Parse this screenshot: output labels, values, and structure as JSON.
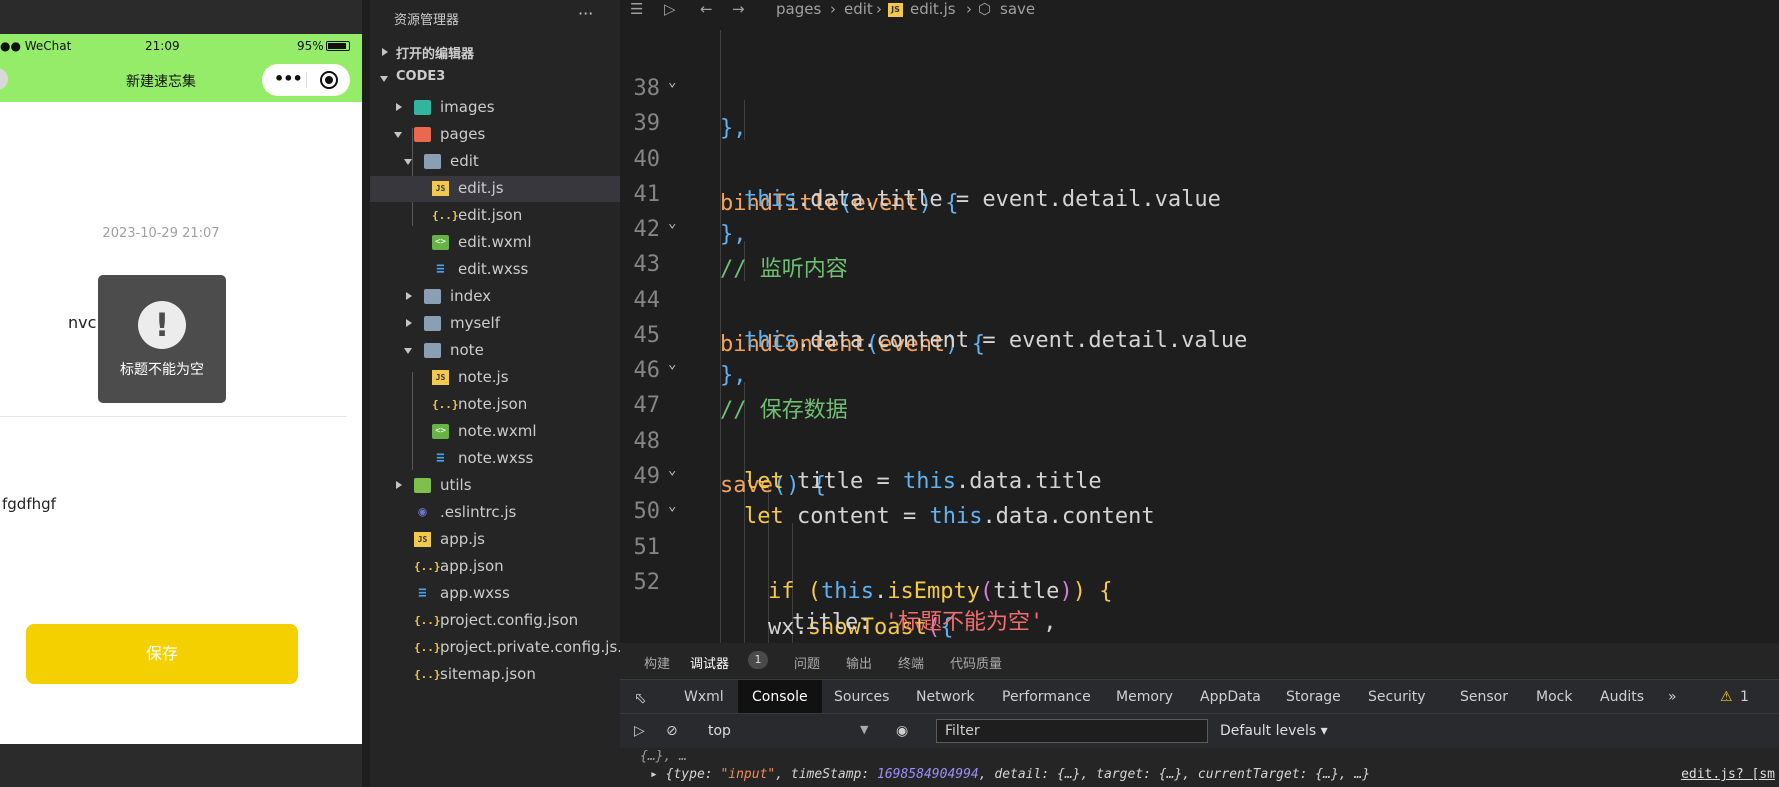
{
  "simulator": {
    "carrier": "●● WeChat",
    "time": "21:09",
    "battery": "95%",
    "nav_title": "新建速忘集",
    "capsule_more": "•••",
    "timestamp": "2023-10-29 21:07",
    "title_value": "nvc",
    "content_value": "fgdfhgf",
    "toast_icon": "!",
    "toast_message": "标题不能为空",
    "save_label": "保存",
    "colors": {
      "navbar": "#95ec69",
      "save_button": "#f5d000",
      "toast": "#4c4c4c"
    }
  },
  "explorer": {
    "header": "资源管理器",
    "more": "···",
    "open_editors": "打开的编辑器",
    "project": "CODE3",
    "tree": [
      {
        "label": "images",
        "icon": "folder-images-icon",
        "type": "folder"
      },
      {
        "label": "pages",
        "icon": "folder-pages-icon",
        "type": "folder"
      },
      {
        "label": "edit",
        "icon": "folder-icon",
        "type": "folder"
      },
      {
        "label": "edit.js",
        "icon": "js-file-icon",
        "type": "file",
        "selected": true
      },
      {
        "label": "edit.json",
        "icon": "json-file-icon",
        "type": "file"
      },
      {
        "label": "edit.wxml",
        "icon": "wxml-file-icon",
        "type": "file"
      },
      {
        "label": "edit.wxss",
        "icon": "wxss-file-icon",
        "type": "file"
      },
      {
        "label": "index",
        "icon": "folder-icon",
        "type": "folder"
      },
      {
        "label": "myself",
        "icon": "folder-icon",
        "type": "folder"
      },
      {
        "label": "note",
        "icon": "folder-icon",
        "type": "folder"
      },
      {
        "label": "note.js",
        "icon": "js-file-icon",
        "type": "file"
      },
      {
        "label": "note.json",
        "icon": "json-file-icon",
        "type": "file"
      },
      {
        "label": "note.wxml",
        "icon": "wxml-file-icon",
        "type": "file"
      },
      {
        "label": "note.wxss",
        "icon": "wxss-file-icon",
        "type": "file"
      },
      {
        "label": "utils",
        "icon": "folder-utils-icon",
        "type": "folder"
      },
      {
        "label": ".eslintrc.js",
        "icon": "eslint-file-icon",
        "type": "file"
      },
      {
        "label": "app.js",
        "icon": "js-file-icon",
        "type": "file"
      },
      {
        "label": "app.json",
        "icon": "json-file-icon",
        "type": "file"
      },
      {
        "label": "app.wxss",
        "icon": "wxss-file-icon",
        "type": "file"
      },
      {
        "label": "project.config.json",
        "icon": "json-file-icon",
        "type": "file"
      },
      {
        "label": "project.private.config.js...",
        "icon": "json-file-icon",
        "type": "file"
      },
      {
        "label": "sitemap.json",
        "icon": "json-file-icon",
        "type": "file"
      }
    ]
  },
  "editor": {
    "breadcrumb": [
      "pages",
      "edit",
      "edit.js",
      "save"
    ],
    "line_numbers": [
      "38",
      "39",
      "40",
      "41",
      "42",
      "43",
      "44",
      "45",
      "46",
      "47",
      "48",
      "49",
      "50",
      "51",
      "52"
    ],
    "code": {
      "l38": "},",
      "l39_fn": "bindTitle",
      "l39_param": "event",
      "l40_this": "this",
      "l40_rest": ".data.title = event.detail.value",
      "l41": "},",
      "l42": "// 监听内容",
      "l43_fn": "bindContent",
      "l43_param": "event",
      "l44_this": "this",
      "l44_rest": ".data.content = event.detail.value",
      "l45": "},",
      "l46": "// 保存数据",
      "l47_fn": "save",
      "l48_let": "let",
      "l48_mid": " title = ",
      "l48_this": "this",
      "l48_rest": ".data.title",
      "l49_let": "let",
      "l49_mid": " content = ",
      "l49_this": "this",
      "l49_rest": ".data.content",
      "l50_if": "if",
      "l50_this": "this",
      "l50_call": "isEmpty",
      "l50_arg": "title",
      "l51_obj": "wx.",
      "l51_call": "showToast",
      "l52_key": "title: ",
      "l52_str": "'标题不能为空'"
    }
  },
  "panel": {
    "tabs": [
      "构建",
      "调试器",
      "问题",
      "输出",
      "终端",
      "代码质量"
    ],
    "debugger_badge": "1",
    "devtools_tabs": [
      "Wxml",
      "Console",
      "Sources",
      "Network",
      "Performance",
      "Memory",
      "AppData",
      "Storage",
      "Security",
      "Sensor",
      "Mock",
      "Audits"
    ],
    "more_tabs": "»",
    "warning_count": "1",
    "context": "top",
    "filter_placeholder": "Filter",
    "levels": "Default levels ▾",
    "log_top": "{…}, …",
    "log": {
      "prefix": "▸ {type: ",
      "type_value": "\"input\"",
      "mid1": ", timeStamp: ",
      "timestamp": "1698584904994",
      "mid2": ", detail: {…}, target: {…}, currentTarget: {…}, …}",
      "link": "edit.js? [sm"
    }
  }
}
